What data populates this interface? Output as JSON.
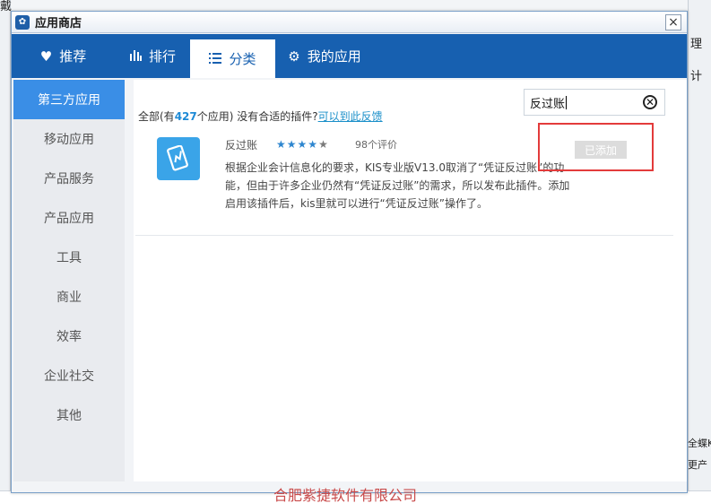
{
  "background": {
    "left_fragment": "戴",
    "right_fragments": [
      "理",
      "计",
      "全蝶K",
      "更产"
    ]
  },
  "dialog": {
    "title": "应用商店",
    "close_glyph": "×"
  },
  "nav": {
    "tabs": [
      {
        "label": "推荐",
        "icon": "heart-icon"
      },
      {
        "label": "排行",
        "icon": "bar-chart-icon"
      },
      {
        "label": "分类",
        "icon": "list-icon"
      },
      {
        "label": "我的应用",
        "icon": "gear-icon"
      }
    ],
    "active_index": 2
  },
  "sidebar": {
    "items": [
      {
        "label": "第三方应用"
      },
      {
        "label": "移动应用"
      },
      {
        "label": "产品服务"
      },
      {
        "label": "产品应用"
      },
      {
        "label": "工具"
      },
      {
        "label": "商业"
      },
      {
        "label": "效率"
      },
      {
        "label": "企业社交"
      },
      {
        "label": "其他"
      }
    ],
    "active_index": 0
  },
  "summary": {
    "prefix": "全部(有",
    "count": "427",
    "suffix": "个应用) 没有合适的插件?",
    "feedback_link": "可以到此反馈"
  },
  "search": {
    "value": "反过账"
  },
  "apps": [
    {
      "name": "反过账",
      "rating": 4,
      "rating_max": 5,
      "reviews": "98个评价",
      "description": "根据企业会计信息化的要求，KIS专业版V13.0取消了“凭证反过账”的功能，但由于许多企业仍然有“凭证反过账”的需求，所以发布此插件。添加启用该插件后，kis里就可以进行“凭证反过账”操作了。",
      "button_label": "已添加"
    }
  ],
  "watermark": "合肥紫捷软件有限公司",
  "colors": {
    "nav_bg": "#1760b0",
    "active_side": "#3a8ee6",
    "highlight": "#e33b3b",
    "link": "#1a8fc9"
  }
}
